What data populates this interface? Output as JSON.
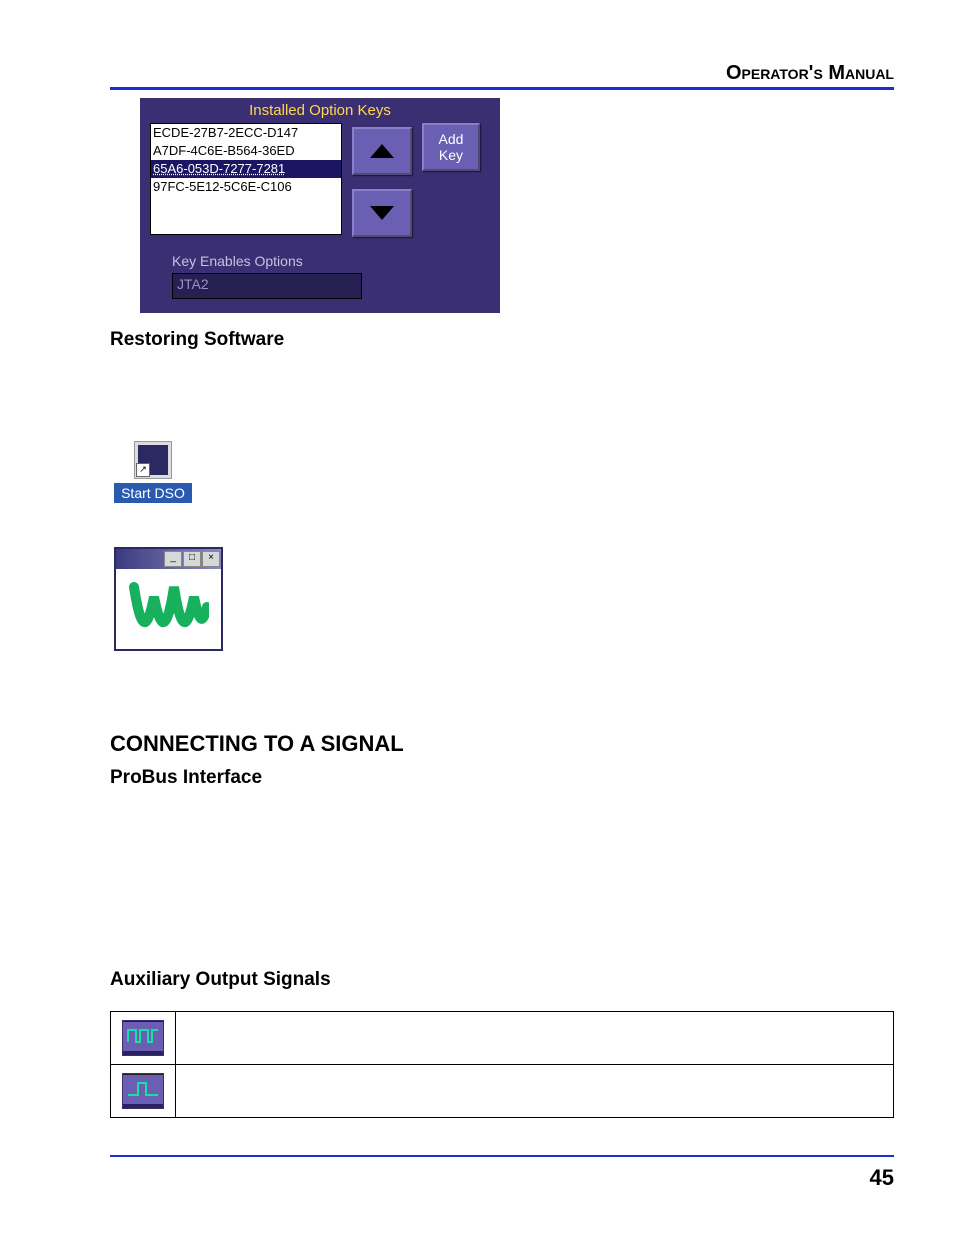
{
  "header": "Operator's Manual",
  "panel": {
    "title": "Installed Option Keys",
    "keys": [
      "ECDE-27B7-2ECC-D147",
      "A7DF-4C6E-B564-36ED",
      "65A6-053D-7277-7281",
      "97FC-5E12-5C6E-C106"
    ],
    "selected_index": 2,
    "add_label": "Add\nKey",
    "sub_label": "Key Enables Options",
    "sub_value": "JTA2"
  },
  "sections": {
    "restore_heading": "Restoring Software",
    "start_dso_label": "Start DSO",
    "connect_heading": "CONNECTING TO A SIGNAL",
    "probus_heading": "ProBus Interface",
    "aux_heading": "Auxiliary Output Signals"
  },
  "titlebar": {
    "min": "_",
    "max": "□",
    "close": "×"
  },
  "aux_rows": [
    {
      "icon": "multi-pulse",
      "text": ""
    },
    {
      "icon": "single-pulse",
      "text": ""
    }
  ],
  "page_number": "45"
}
